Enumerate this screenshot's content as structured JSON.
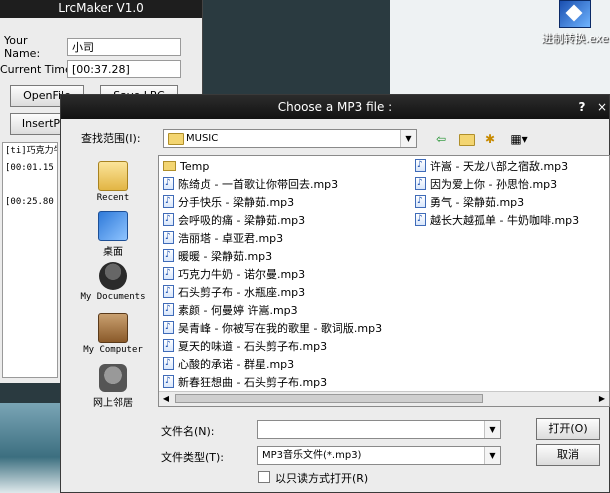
{
  "desktop": {
    "icon_label": "进制转换.exe"
  },
  "lrcmaker": {
    "title": "LrcMaker V1.0",
    "your_name_label": "Your Name:",
    "your_name_value": "小司",
    "current_time_label": "Current Time :",
    "current_time_value": "[00:37.28]",
    "openfile_label": "OpenFile",
    "savelrc_label": "Save LRC",
    "insertpos_label": "InsertPos",
    "lyrics_lines": [
      "[ti]巧克力牛",
      "[00:01.15",
      "",
      "[00:25.80"
    ]
  },
  "dialog": {
    "title": "Choose a MP3 file :",
    "help_symbol": "?",
    "close_symbol": "×",
    "look_in_label": "查找范围(I):",
    "look_in_value": "MUSIC",
    "places": [
      {
        "label": "Recent",
        "icon": "recent-folder-icon"
      },
      {
        "label": "桌面",
        "icon": "desktop-icon"
      },
      {
        "label": "My Documents",
        "icon": "my-documents-icon"
      },
      {
        "label": "My Computer",
        "icon": "my-computer-icon"
      },
      {
        "label": "网上邻居",
        "icon": "network-icon"
      }
    ],
    "folders": [
      "Temp"
    ],
    "files_col1": [
      "陈绮贞 - 一首歌让你带回去.mp3",
      "分手快乐 - 梁静茹.mp3",
      "会呼吸的痛 - 梁静茹.mp3",
      "浩丽塔 - 卓亚君.mp3",
      "暖暖 - 梁静茹.mp3",
      "巧克力牛奶 - 诺尔曼.mp3",
      "石头剪子布 - 水瓶座.mp3",
      "素颜 - 何曼婷 许嵩.mp3",
      "吴青峰 - 你被写在我的歌里 - 歌词版.mp3",
      "夏天的味道 - 石头剪子布.mp3",
      "心酸的承诺 - 群星.mp3",
      "新春狂想曲 - 石头剪子布.mp3"
    ],
    "files_col2": [
      "许嵩 - 天龙八部之宿敌.mp3",
      "因为爱上你 - 孙思怡.mp3",
      "勇气 - 梁静茹.mp3",
      "越长大越孤单 - 牛奶咖啡.mp3"
    ],
    "file_name_label": "文件名(N):",
    "file_name_value": "",
    "file_type_label": "文件类型(T):",
    "file_type_value": "MP3音乐文件(*.mp3)",
    "open_label": "打开(O)",
    "cancel_label": "取消",
    "readonly_label": "以只读方式打开(R)",
    "readonly_checked": false
  }
}
